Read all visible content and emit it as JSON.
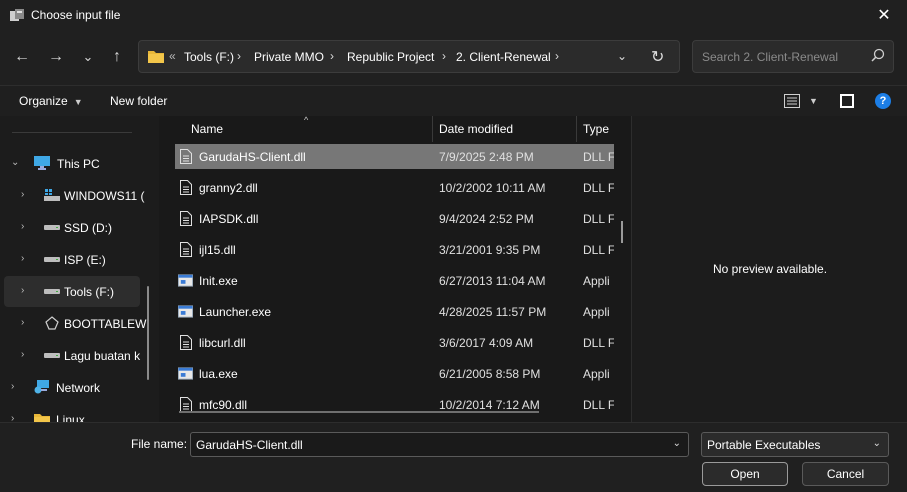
{
  "window": {
    "title": "Choose input file",
    "close": "✕"
  },
  "nav": {
    "back": "←",
    "forward": "→",
    "recent": "⌄",
    "up": "↑",
    "address": {
      "overflow": "«",
      "crumbs": [
        "Tools (F:)",
        "Private MMO",
        "Republic Project",
        "2. Client-Renewal"
      ],
      "separator": "›",
      "dropdown": "⌄",
      "refresh": "↻"
    },
    "search": {
      "placeholder": "Search 2. Client-Renewal"
    }
  },
  "toolbar": {
    "organize": "Organize",
    "organize_chev": "▼",
    "new_folder": "New folder",
    "view_chev": "▼",
    "help": "?"
  },
  "navpane": {
    "items": [
      {
        "label": "This PC",
        "icon": "monitor-icon",
        "chevron": "⌄"
      },
      {
        "label": "WINDOWS11 (",
        "icon": "windows-drive-icon",
        "chevron": "›"
      },
      {
        "label": "SSD (D:)",
        "icon": "drive-icon",
        "chevron": "›"
      },
      {
        "label": "ISP (E:)",
        "icon": "drive-icon",
        "chevron": "›"
      },
      {
        "label": "Tools (F:)",
        "icon": "drive-icon",
        "chevron": "›"
      },
      {
        "label": "BOOTTABLEWI",
        "icon": "disc-icon",
        "chevron": "›"
      },
      {
        "label": "Lagu buatan k",
        "icon": "drive-icon",
        "chevron": "›"
      },
      {
        "label": "Network",
        "icon": "network-icon",
        "chevron": "›"
      },
      {
        "label": "Linux",
        "icon": "folder-icon",
        "chevron": "›"
      }
    ]
  },
  "files": {
    "columns": {
      "name": "Name",
      "date": "Date modified",
      "type": "Type",
      "sort_arrow": "^"
    },
    "rows": [
      {
        "name": "GarudaHS-Client.dll",
        "date": "7/9/2025 2:48 PM",
        "type": "DLL F",
        "icon": "dll-icon",
        "selected": true
      },
      {
        "name": "granny2.dll",
        "date": "10/2/2002 10:11 AM",
        "type": "DLL F",
        "icon": "dll-icon"
      },
      {
        "name": "IAPSDK.dll",
        "date": "9/4/2024 2:52 PM",
        "type": "DLL F",
        "icon": "dll-icon"
      },
      {
        "name": "ijl15.dll",
        "date": "3/21/2001 9:35 PM",
        "type": "DLL F",
        "icon": "dll-icon"
      },
      {
        "name": "Init.exe",
        "date": "6/27/2013 11:04 AM",
        "type": "Appli",
        "icon": "exe-icon"
      },
      {
        "name": "Launcher.exe",
        "date": "4/28/2025 11:57 PM",
        "type": "Appli",
        "icon": "exe-icon"
      },
      {
        "name": "libcurl.dll",
        "date": "3/6/2017 4:09 AM",
        "type": "DLL F",
        "icon": "dll-icon"
      },
      {
        "name": "lua.exe",
        "date": "6/21/2005 8:58 PM",
        "type": "Appli",
        "icon": "exe-icon"
      },
      {
        "name": "mfc90.dll",
        "date": "10/2/2014 7:12 AM",
        "type": "DLL F",
        "icon": "dll-icon"
      }
    ]
  },
  "preview": {
    "text": "No preview available."
  },
  "bottom": {
    "file_name_label": "File name:",
    "file_name_value": "GarudaHS-Client.dll",
    "file_type": "Portable Executables",
    "chev": "⌄",
    "open": "Open",
    "cancel": "Cancel"
  },
  "colors": {
    "selected_row": "#777777",
    "accent": "#1c7ee6",
    "folder": "#e8b739"
  }
}
